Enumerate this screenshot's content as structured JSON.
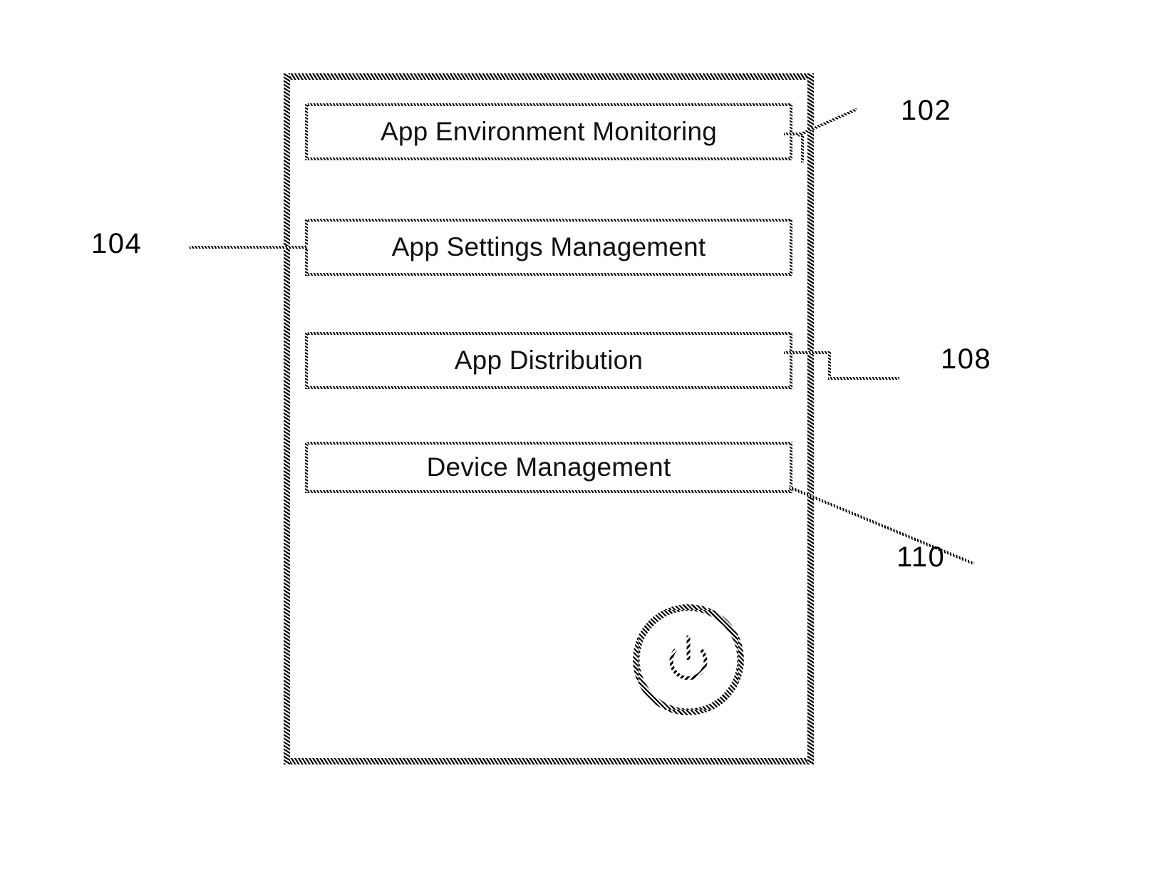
{
  "figure": {
    "type": "patent-block-diagram",
    "background_color": "#ffffff",
    "line_color": "#000000",
    "device": {
      "name": "device-outline",
      "reference_numeral": "102"
    },
    "modules": [
      {
        "id": "monitoring",
        "label": "App Environment Monitoring",
        "reference_numeral": "102"
      },
      {
        "id": "settings",
        "label": "App Settings Management",
        "reference_numeral": "104"
      },
      {
        "id": "distribution",
        "label": "App Distribution",
        "reference_numeral": "108"
      },
      {
        "id": "device",
        "label": "Device Management",
        "reference_numeral": "110"
      }
    ],
    "reference_numerals": {
      "r102": "102",
      "r104": "104",
      "r108": "108",
      "r110": "110"
    },
    "power_button": {
      "icon": "power-icon",
      "label": ""
    }
  }
}
